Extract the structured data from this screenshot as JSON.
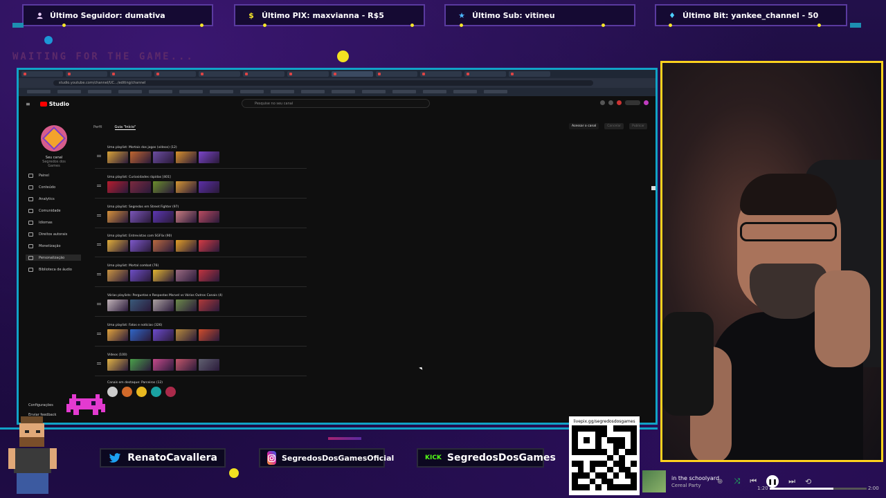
{
  "overlay": {
    "alerts": [
      {
        "icon": "person-icon",
        "text": "Último Seguidor: dumativa"
      },
      {
        "icon": "dollar-icon",
        "text": "Último PIX: maxvianna - R$5"
      },
      {
        "icon": "star-icon",
        "text": "Último Sub: vitineu"
      },
      {
        "icon": "diamond-icon",
        "text": "Último Bit: yankee_channel - 50"
      }
    ],
    "waiting_text": "WAITING FOR THE GAME..."
  },
  "browser": {
    "url": "studio.youtube.com/channel/UC.../editing/channel",
    "app_name": "Studio",
    "search_placeholder": "Pesquise no seu canal",
    "channel_name": "Seu canal",
    "channel_handle": "Segredos dos Games",
    "custom_tabs": [
      "Perfil",
      "Guia \"Início\""
    ],
    "head_buttons": [
      "Acessar o canal",
      "Cancelar",
      "Publicar"
    ],
    "nav": [
      {
        "icon": "dashboard-icon",
        "label": "Painel"
      },
      {
        "icon": "content-icon",
        "label": "Conteúdo"
      },
      {
        "icon": "analytics-icon",
        "label": "Analytics"
      },
      {
        "icon": "community-icon",
        "label": "Comunidade"
      },
      {
        "icon": "subtitles-icon",
        "label": "Idiomas"
      },
      {
        "icon": "copyright-icon",
        "label": "Direitos autorais"
      },
      {
        "icon": "money-icon",
        "label": "Monetização"
      },
      {
        "icon": "customization-icon",
        "label": "Personalização"
      },
      {
        "icon": "audio-library-icon",
        "label": "Biblioteca de áudio"
      }
    ],
    "settings_label": "Configurações",
    "feedback_label": "Enviar feedback",
    "sections": [
      {
        "label": "Uma playlist: Mortais dos jogos (vídeos) (12)",
        "thumbs": [
          "#d8a237",
          "#c0662f",
          "#6b4da0",
          "#d8922c",
          "#7b45c9"
        ]
      },
      {
        "label": "Uma playlist: Curiosidades rápidas [401]",
        "thumbs": [
          "#b51d2e",
          "#7b2a3f",
          "#6a8d2b",
          "#d49633",
          "#5b2fa6"
        ]
      },
      {
        "label": "Uma playlist: Segredos em Street Fighter (97)",
        "thumbs": [
          "#d5913a",
          "#7a55b8",
          "#5c37b2",
          "#c87b7f",
          "#b94b60"
        ]
      },
      {
        "label": "Uma playlist: Entrevistas com SGFlix (90)",
        "thumbs": [
          "#e0ad3a",
          "#7d58c9",
          "#b8693f",
          "#e19e27",
          "#d33b44"
        ]
      },
      {
        "label": "Uma playlist: Mortal combat (76)",
        "thumbs": [
          "#c99442",
          "#6d4ec4",
          "#e1b331",
          "#9a6a80",
          "#c1343f"
        ]
      },
      {
        "label": "Várias playlists: Perguntas e Respostas Marvel vs Vários Outros Canais (4)",
        "thumbs": [
          "#c1b3b8",
          "#3a5a7a",
          "#aaa0a0",
          "#6c8a4a",
          "#b03a3a"
        ]
      },
      {
        "label": "Uma playlist: Fatos e notícias (326)",
        "thumbs": [
          "#e0a23c",
          "#3066c6",
          "#6c4ccc",
          "#b68a3c",
          "#cf4d2c"
        ]
      },
      {
        "label": "Vídeos (100)",
        "thumbs": [
          "#e0b245",
          "#4aa04a",
          "#c44a8a",
          "#c2566a",
          "#606070"
        ]
      }
    ],
    "featured_label": "Canais em destaque: Parceiros (12)",
    "featured_channels": [
      "#cccccc",
      "#d26a2a",
      "#e8b820",
      "#1aa2a2",
      "#aa2a4a"
    ]
  },
  "social": [
    {
      "icon": "twitter-icon",
      "name": "RenatoCavallera"
    },
    {
      "icon": "instagram-icon",
      "name": "SegredosDosGamesOficial"
    },
    {
      "icon": "kick-icon",
      "name": "SegredosDosGames"
    }
  ],
  "kick_label": "KICK",
  "qr_text": "livepix.gg/segredosdosgames",
  "music": {
    "title": "in the schoolyard",
    "artist": "Cereal Party",
    "current": "1:20",
    "total": "2:00",
    "progress": 0.66,
    "play_state": "paused"
  },
  "colors": {
    "accent_cyan": "#11a3c7",
    "webcam_border": "#ffd21e",
    "bg_purple": "#1c0b3b"
  }
}
